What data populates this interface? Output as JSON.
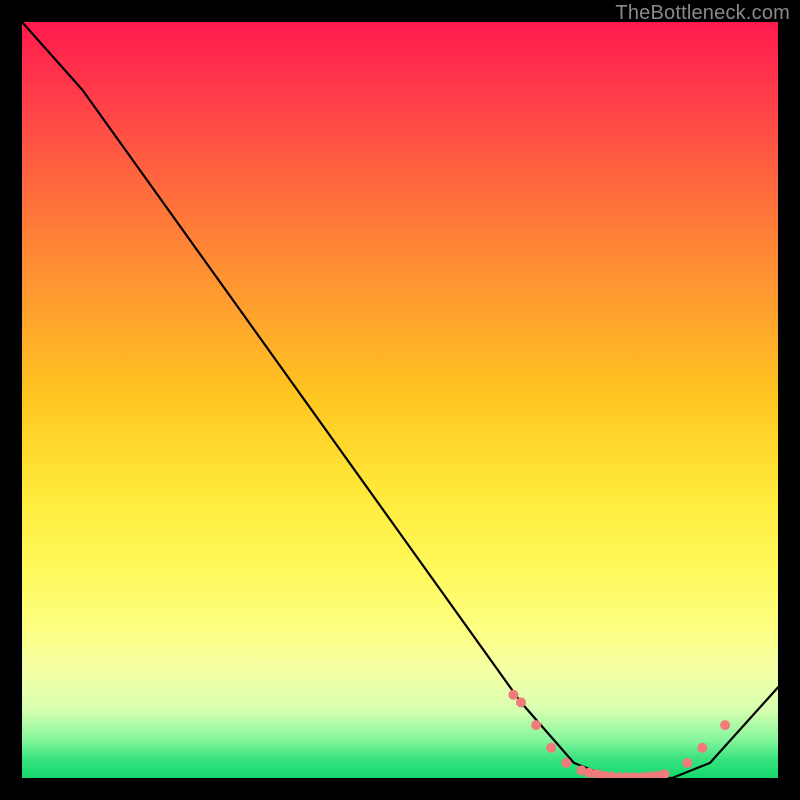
{
  "watermark": "TheBottleneck.com",
  "chart_data": {
    "type": "line",
    "title": "",
    "xlabel": "",
    "ylabel": "",
    "xlim": [
      0,
      100
    ],
    "ylim": [
      0,
      100
    ],
    "series": [
      {
        "name": "curve",
        "x": [
          0,
          8,
          66,
          73,
          78,
          82,
          86,
          91,
          100
        ],
        "y": [
          100,
          91,
          10,
          2,
          0,
          0,
          0,
          2,
          12
        ]
      }
    ],
    "markers": {
      "name": "dots",
      "color": "#ef7b7b",
      "x": [
        65,
        66,
        68,
        70,
        72,
        74,
        75,
        76,
        77,
        78,
        79,
        80,
        81,
        82,
        83,
        84,
        85,
        88,
        90,
        93
      ],
      "y": [
        11,
        10,
        7,
        4,
        2,
        1,
        0.7,
        0.5,
        0.3,
        0.2,
        0.1,
        0.1,
        0.1,
        0.1,
        0.2,
        0.3,
        0.5,
        2,
        4,
        7
      ]
    }
  }
}
